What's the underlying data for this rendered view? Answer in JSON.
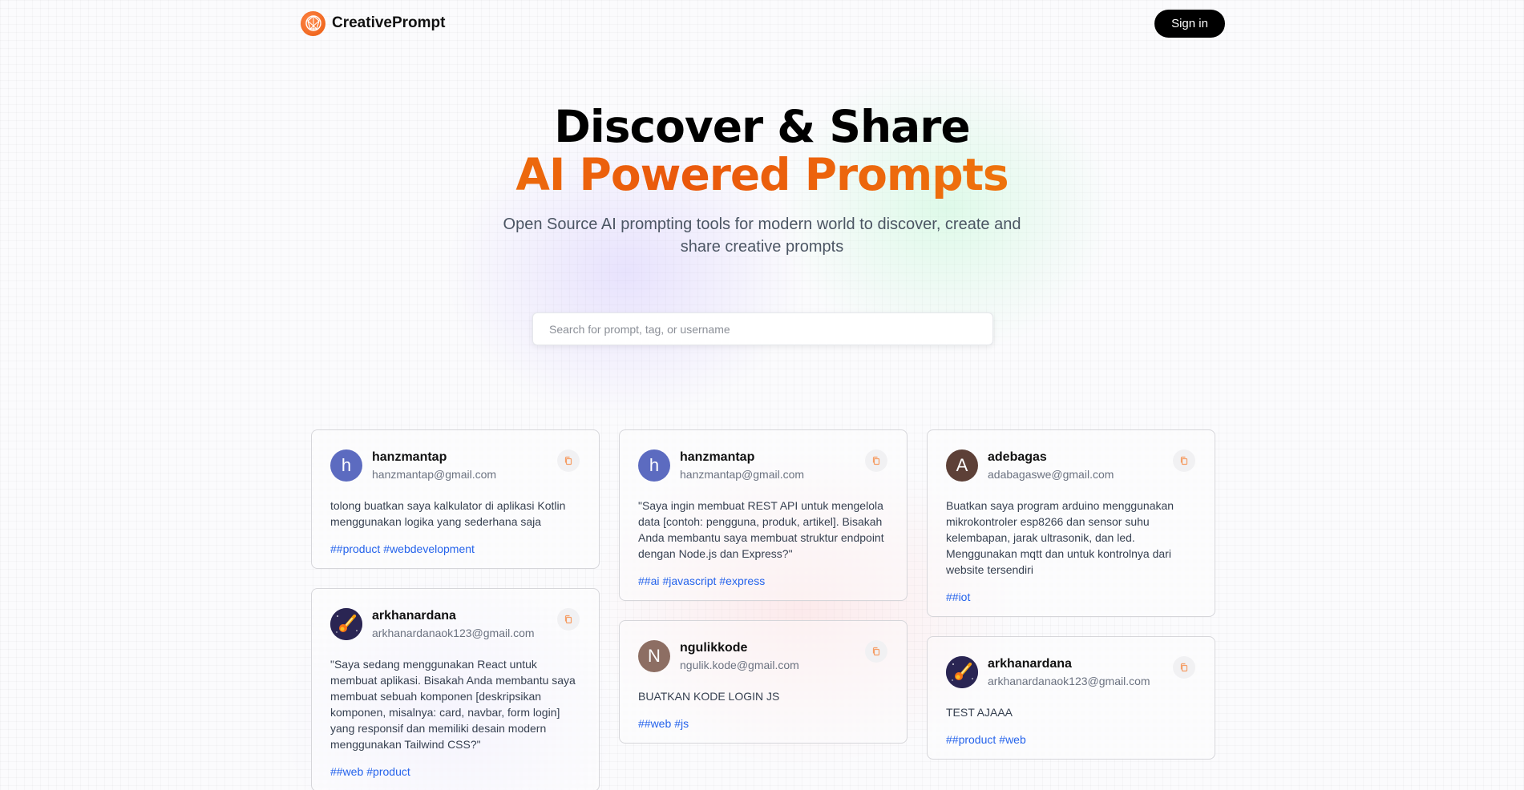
{
  "brand": {
    "name": "CreativePrompt"
  },
  "nav": {
    "signin_label": "Sign in"
  },
  "hero": {
    "title_line1": "Discover & Share",
    "title_line2": "AI Powered Prompts",
    "subtitle": "Open Source AI prompting tools for modern world to discover, create and share creative prompts"
  },
  "search": {
    "placeholder": "Search for prompt, tag, or username",
    "value": ""
  },
  "colors": {
    "accent": "#ea580c",
    "tag": "#2563eb"
  },
  "columns": [
    [
      {
        "username": "hanzmantap",
        "email": "hanzmantap@gmail.com",
        "avatar_letter": "h",
        "avatar_color": "#5c6bc0",
        "prompt": "tolong buatkan saya kalkulator di aplikasi Kotlin menggunakan logika yang sederhana saja",
        "tags": [
          "##product",
          "#webdevelopment"
        ]
      },
      {
        "username": "arkhanardana",
        "email": "arkhanardanaok123@gmail.com",
        "avatar_letter": "",
        "avatar_icon": "comet-icon",
        "avatar_color": "#2a2553",
        "prompt": "\"Saya sedang menggunakan React untuk membuat aplikasi. Bisakah Anda membantu saya membuat sebuah komponen [deskripsikan komponen, misalnya: card, navbar, form login] yang responsif dan memiliki desain modern menggunakan Tailwind CSS?\"",
        "tags": [
          "##web",
          "#product"
        ]
      }
    ],
    [
      {
        "username": "hanzmantap",
        "email": "hanzmantap@gmail.com",
        "avatar_letter": "h",
        "avatar_color": "#5c6bc0",
        "prompt": "\"Saya ingin membuat REST API untuk mengelola data [contoh: pengguna, produk, artikel]. Bisakah Anda membantu saya membuat struktur endpoint dengan Node.js dan Express?\"",
        "tags": [
          "##ai",
          "#javascript",
          "#express"
        ]
      },
      {
        "username": "ngulikkode",
        "email": "ngulik.kode@gmail.com",
        "avatar_letter": "N",
        "avatar_color": "#8d6e63",
        "prompt": "BUATKAN KODE LOGIN JS",
        "tags": [
          "##web",
          "#js"
        ]
      }
    ],
    [
      {
        "username": "adebagas",
        "email": "adabagaswe@gmail.com",
        "avatar_letter": "A",
        "avatar_color": "#5d4037",
        "prompt": "Buatkan saya program arduino menggunakan mikrokontroler esp8266 dan sensor suhu kelembapan, jarak ultrasonik, dan led. Menggunakan mqtt dan untuk kontrolnya dari website tersendiri",
        "tags": [
          "##iot"
        ]
      },
      {
        "username": "arkhanardana",
        "email": "arkhanardanaok123@gmail.com",
        "avatar_letter": "",
        "avatar_icon": "comet-icon",
        "avatar_color": "#2a2553",
        "prompt": "TEST AJAAA",
        "tags": [
          "##product",
          "#web"
        ]
      }
    ]
  ]
}
